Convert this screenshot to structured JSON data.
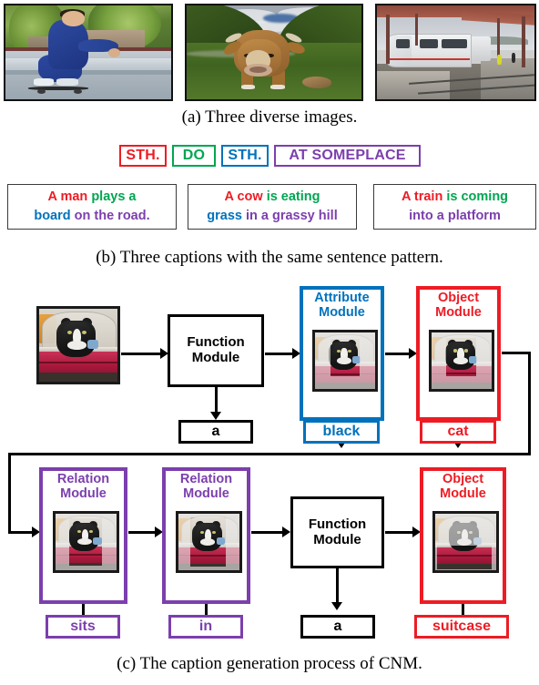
{
  "figure": {
    "panel_a": {
      "caption": "(a) Three diverse images.",
      "images": [
        {
          "name": "skateboarder-photo",
          "alt": "A man crouching on a skateboard on a concrete ledge"
        },
        {
          "name": "cow-photo",
          "alt": "A brown cow standing in a green grassy hill valley"
        },
        {
          "name": "train-photo",
          "alt": "A white passenger train arriving at a station platform"
        }
      ]
    },
    "panel_b": {
      "caption": "(b) Three captions with the same sentence pattern.",
      "pattern_chips": [
        {
          "label": "STH.",
          "color": "#ed1c24"
        },
        {
          "label": "DO",
          "color": "#00a651"
        },
        {
          "label": "STH.",
          "color": "#0072bc"
        },
        {
          "label": "AT SOMEPLACE",
          "color": "#7c3fad"
        }
      ],
      "captions": [
        {
          "lines": [
            [
              {
                "text": "A man ",
                "role": "sth1"
              },
              {
                "text": "plays a",
                "role": "do"
              }
            ],
            [
              {
                "text": "board ",
                "role": "sth2"
              },
              {
                "text": "on the road.",
                "role": "place"
              }
            ]
          ]
        },
        {
          "lines": [
            [
              {
                "text": "A cow ",
                "role": "sth1"
              },
              {
                "text": "is eating",
                "role": "do"
              }
            ],
            [
              {
                "text": "grass ",
                "role": "sth2"
              },
              {
                "text": "in a grassy hill",
                "role": "place"
              }
            ]
          ]
        },
        {
          "lines": [
            [
              {
                "text": "A train ",
                "role": "sth1"
              },
              {
                "text": "is coming",
                "role": "do"
              }
            ],
            [
              {
                "text": "into a platform",
                "role": "place"
              }
            ]
          ]
        }
      ]
    },
    "panel_c": {
      "caption": "(c) The caption generation process of CNM.",
      "input_image": {
        "name": "cat-in-suitcase-photo",
        "alt": "A black and white cat sitting inside an open red suitcase"
      },
      "modules": {
        "function_top": "Function\nModule",
        "attribute": "Attribute\nModule",
        "object_top": "Object\nModule",
        "relation_1": "Relation\nModule",
        "relation_2": "Relation\nModule",
        "function_bottom": "Function\nModule",
        "object_bottom": "Object\nModule"
      },
      "words": {
        "a_top": "a",
        "black": "black",
        "cat": "cat",
        "sits": "sits",
        "in": "in",
        "a_bottom": "a",
        "suitcase": "suitcase"
      }
    }
  },
  "colors": {
    "red": "#ed1c24",
    "green": "#00a651",
    "blue": "#0072bc",
    "purple": "#7c3fad",
    "black": "#000000"
  }
}
